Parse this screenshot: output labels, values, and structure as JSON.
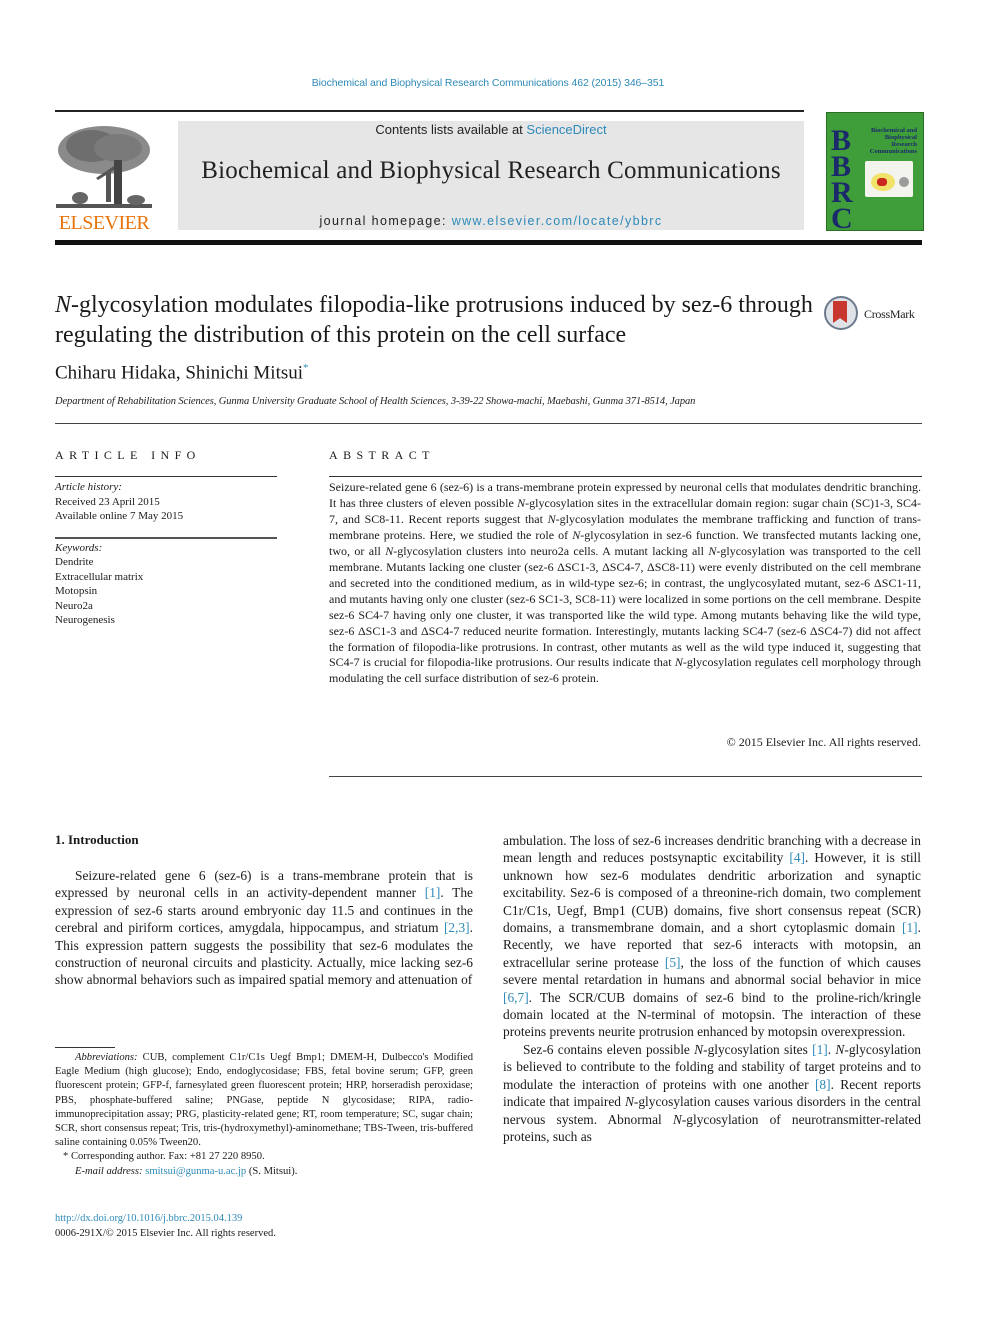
{
  "citation": "Biochemical and Biophysical Research Communications 462 (2015) 346–351",
  "header": {
    "publisher_logo": "ELSEVIER",
    "contents_prefix": "Contents lists available at ",
    "contents_link": "ScienceDirect",
    "journal_title": "Biochemical and Biophysical Research Communications",
    "homepage_prefix": "journal homepage: ",
    "homepage_link": "www.elsevier.com/locate/ybbrc",
    "cover": {
      "letters": [
        "B",
        "B",
        "R",
        "C"
      ],
      "title": "Biochemical and Biophysical Research Communications",
      "bg_color": "#3f9e3a",
      "letter_color": "#1b2a6b"
    }
  },
  "article": {
    "title_italic": "N",
    "title_rest": "-glycosylation modulates filopodia-like protrusions induced by sez-6 through regulating the distribution of this protein on the cell surface",
    "crossmark_label": "CrossMark",
    "authors": "Chiharu Hidaka, Shinichi Mitsui",
    "author_mark": "*",
    "affiliation": "Department of Rehabilitation Sciences, Gunma University Graduate School of Health Sciences, 3-39-22 Showa-machi, Maebashi, Gunma 371-8514, Japan"
  },
  "article_info": {
    "heading": "ARTICLE INFO",
    "history_label": "Article history:",
    "received": "Received 23 April 2015",
    "available": "Available online 7 May 2015",
    "keywords_label": "Keywords:",
    "keywords": [
      "Dendrite",
      "Extracellular matrix",
      "Motopsin",
      "Neuro2a",
      "Neurogenesis"
    ]
  },
  "abstract": {
    "heading": "ABSTRACT",
    "text": "Seizure-related gene 6 (sez-6) is a trans-membrane protein expressed by neuronal cells that modu­lates dendritic branching. It has three clusters of eleven possible N-glycosylation sites in the extra­cellular domain region: sugar chain (SC)1-3, SC4-7, and SC8-11. Recent reports suggest that N-glycosylation modulates the membrane trafficking and function of trans-membrane proteins. Here, we studied the role of N-glycosylation in sez-6 function. We transfected mutants lacking one, two, or all N-glycosylation clusters into neuro2a cells. A mutant lacking all N-glycosylation was transported to the cell membrane. Mutants lacking one cluster (sez-6 ΔSC1-3, ΔSC4-7, ΔSC8-11) were evenly distributed on the cell membrane and secreted into the conditioned medium, as in wild-type sez-6; in contrast, the unglycosylated mutant, sez-6 ΔSC1-11, and mutants having only one cluster (sez-6 SC1-3, SC8-11) were localized in some portions on the cell membrane. Despite sez-6 SC4-7 having only one cluster, it was transported like the wild type. Among mutants behaving like the wild type, sez-6 ΔSC1-3 and ΔSC4-7 reduced neurite formation. Interestingly, mutants lacking SC4-7 (sez-6 ΔSC4-7) did not affect the formation of filopodia-like protrusions. In contrast, other mutants as well as the wild type induced it, suggesting that SC4-7 is crucial for filopodia-like protrusions. Our results indicate that N-glycosylation regulates cell morphology through modulating the cell surface distri­bution of sez-6 protein.",
    "copyright": "© 2015 Elsevier Inc. All rights reserved."
  },
  "introduction": {
    "heading": "1.  Introduction",
    "left_col": [
      {
        "t": "Seizure-related gene 6 (sez-6) is a trans-membrane protein that is expressed by neuronal cells in an activity-dependent manner "
      },
      {
        "ref": "[1]"
      },
      {
        "t": ". The expression of sez-6 starts around embryonic day 11.5 and continues in the cerebral and piriform cortices, amygdala, hippo­campus, and striatum "
      },
      {
        "ref": "[2,3]"
      },
      {
        "t": ". This expression pattern suggests the possibility that sez-6 modulates the construction of neuronal cir­cuits and plasticity. Actually, mice lacking sez-6 show abnormal behaviors such as impaired spatial memory and attenuation of"
      }
    ],
    "right_p1": [
      {
        "t": "ambulation. The loss of sez-6 increases dendritic branching with a decrease in mean length and reduces postsynaptic excitability "
      },
      {
        "ref": "[4]"
      },
      {
        "t": ". However, it is still unknown how sez-6 modulates dendritic arborization and synaptic excitability. Sez-6 is composed of a threonine-rich domain, two complement C1r/C1s, Uegf, Bmp1 (CUB) domains, five short consensus repeat (SCR) domains, a transmembrane domain, and a short cytoplasmic domain "
      },
      {
        "ref": "[1]"
      },
      {
        "t": ". Recently, we have reported that sez-6 interacts with motopsin, an extracellular serine protease "
      },
      {
        "ref": "[5]"
      },
      {
        "t": ", the loss of the function of which causes severe mental retardation in humans and abnormal social behavior in mice "
      },
      {
        "ref": "[6,7]"
      },
      {
        "t": ". The SCR/CUB domains of sez-6 bind to the proline-rich/kringle domain located at the N-terminal of motopsin. The interaction of these proteins prevents neurite protrusion enhanced by motopsin overexpression."
      }
    ],
    "right_p2": [
      {
        "t": "Sez-6 contains eleven possible "
      },
      {
        "i": "N"
      },
      {
        "t": "-glycosylation sites "
      },
      {
        "ref": "[1]"
      },
      {
        "t": ". "
      },
      {
        "i": "N"
      },
      {
        "t": "-glycosylation is believed to contribute to the folding and stability of target proteins and to modulate the interaction of proteins with one another "
      },
      {
        "ref": "[8]"
      },
      {
        "t": ". Recent reports indicate that impaired "
      },
      {
        "i": "N"
      },
      {
        "t": "-glycosylation causes various disorders in the central nervous system. Abnormal "
      },
      {
        "i": "N"
      },
      {
        "t": "-glycosylation of neurotransmitter-related proteins, such as"
      }
    ]
  },
  "footnotes": {
    "abbrev_label": "Abbreviations:",
    "abbrev_text": " CUB, complement C1r/C1s Uegf Bmp1; DMEM-H, Dulbecco's Modified Eagle Medium (high glucose); Endo, endoglycosidase; FBS, fetal bovine serum; GFP, green fluorescent protein; GFP-f, farnesylated green fluorescent pro­tein; HRP, horseradish peroxidase; PBS, phosphate-buffered saline; PNGase, peptide N glycosidase; RIPA, radio-immunoprecipitation assay; PRG, plasticity-related gene; RT, room temperature; SC, sugar chain; SCR, short consensus repeat; Tris, tris-(hydroxymethyl)-aminomethane; TBS-Tween, tris-buffered saline containing 0.05% Tween20.",
    "corresponding": "* Corresponding author. Fax: +81 27 220 8950.",
    "email_label": "E-mail address:",
    "email": "smitsui@gunma-u.ac.jp",
    "email_suffix": " (S. Mitsui)."
  },
  "doi": {
    "link": "http://dx.doi.org/10.1016/j.bbrc.2015.04.139",
    "issn_line": "0006-291X/© 2015 Elsevier Inc. All rights reserved."
  },
  "colors": {
    "link": "#2e8ab8",
    "elsevier_orange": "#e8740c",
    "journal_band": "#e6e6e6",
    "crossmark_red": "#c8372d"
  }
}
